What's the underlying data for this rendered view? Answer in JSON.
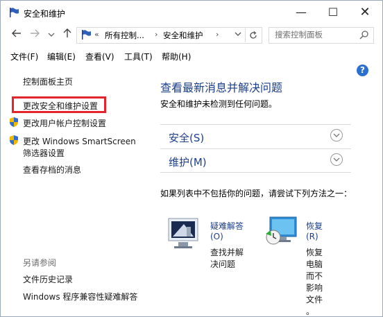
{
  "window": {
    "title": "安全和维护",
    "controls": {
      "minimize": "—",
      "maximize": "☐",
      "close": "✕"
    }
  },
  "navigation": {
    "back_icon": "back-arrow-icon",
    "forward_icon": "forward-arrow-icon",
    "recent_icon": "chevron-down-icon",
    "up_icon": "up-arrow-icon",
    "breadcrumb_prefix": "«",
    "breadcrumb": [
      "所有控制...",
      "安全和维护"
    ],
    "breadcrumb_separators": [
      "›",
      "›"
    ],
    "search_placeholder": "搜索控制面板"
  },
  "menu": [
    "文件(F)",
    "编辑(E)",
    "查看(V)",
    "工具(T)",
    "帮助(H)"
  ],
  "sidebar": {
    "home": "控制面板主页",
    "change_security": "更改安全和维护设置",
    "change_uac": "更改用户帐户控制设置",
    "smartscreen_line1": "更改 Windows SmartScreen",
    "smartscreen_line2": "筛选器设置",
    "archived": "查看存档的消息",
    "see_also": "另请参阅",
    "file_history": "文件历史记录",
    "compat": "Windows 程序兼容性疑难解答"
  },
  "main": {
    "title": "查看最新消息并解决问题",
    "subtitle": "安全和维护未检测到任何问题。",
    "sections": [
      "安全(S)",
      "维护(M)"
    ],
    "if_not_listed": "如果列表中不包括你的问题，请尝试下列方法之一：",
    "troubleshoot": {
      "link1": "疑难解答",
      "link2": "(O)",
      "desc1": "查找并解",
      "desc2": "决问题"
    },
    "recovery": {
      "link1": "恢复",
      "link2": "(R)",
      "desc": [
        "恢复",
        "电脑",
        "而不",
        "影响",
        "文件",
        "。"
      ]
    }
  },
  "colors": {
    "link": "#1b3f8b",
    "highlight": "#e5232a",
    "help": "#2b6fcf"
  }
}
